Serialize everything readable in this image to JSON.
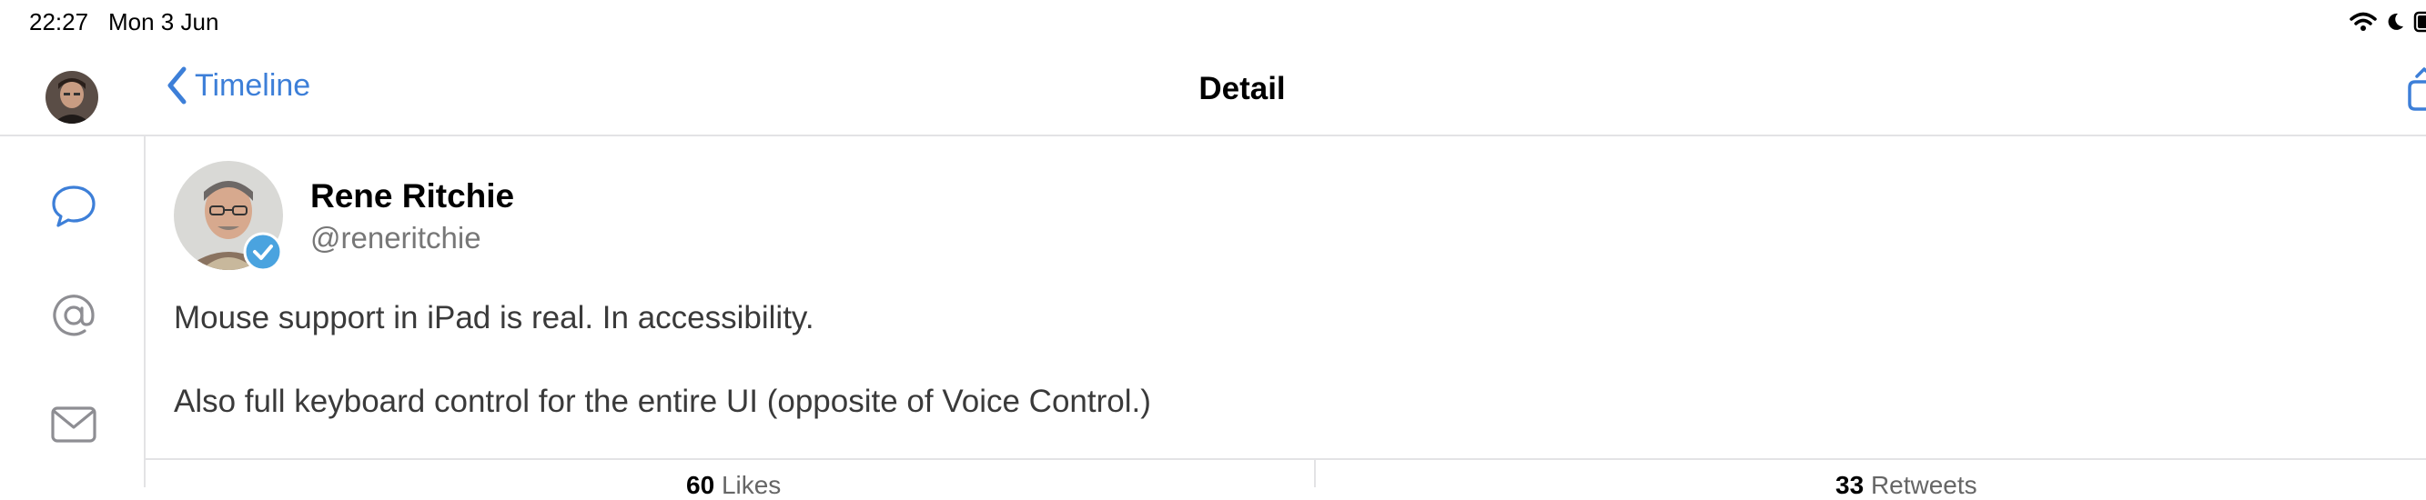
{
  "status_bar": {
    "time": "22:27",
    "date": "Mon 3 Jun",
    "icons": [
      "wifi-icon",
      "moon-icon",
      "battery-icon"
    ]
  },
  "nav": {
    "back_label": "Timeline",
    "title": "Detail",
    "icons": [
      "avatar",
      "chevron-left-icon",
      "share-icon"
    ]
  },
  "sidebar": {
    "items": [
      {
        "name": "chat-bubble-icon",
        "active": true
      },
      {
        "name": "at-sign-icon",
        "active": false
      },
      {
        "name": "envelope-icon",
        "active": false
      }
    ]
  },
  "tweet": {
    "author_name": "Rene Ritchie",
    "author_handle": "@reneritchie",
    "verified": true,
    "text_line1": "Mouse support in iPad is real. In accessibility.",
    "text_line2": "Also full keyboard control for the entire UI (opposite of Voice Control.)",
    "likes_count": "60",
    "likes_label": "Likes",
    "retweets_count": "33",
    "retweets_label": "Retweets"
  },
  "colors": {
    "accent": "#3d7fd8",
    "verified": "#4aa3df",
    "divider": "#e3e3e5",
    "body_text": "#3a3a3a",
    "muted": "#777777"
  }
}
